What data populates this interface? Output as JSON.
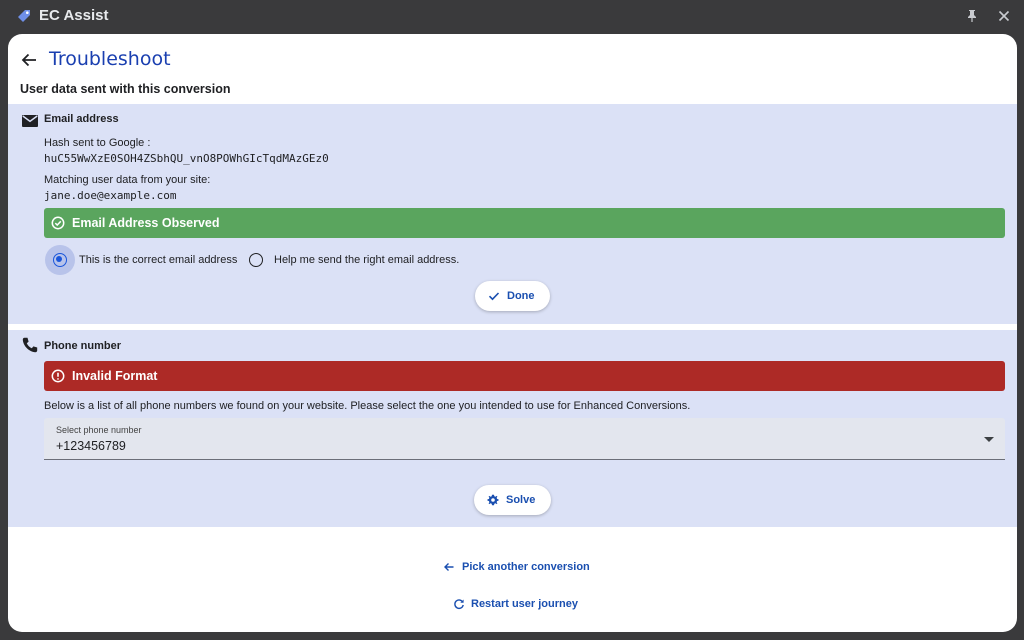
{
  "app": {
    "title": "EC Assist",
    "icon": "tag-icon",
    "pin_icon": "pin-icon",
    "close_icon": "close-icon"
  },
  "header": {
    "title": "Troubleshoot",
    "back_icon": "arrow-back-icon"
  },
  "section_heading": "User data sent with this conversion",
  "email": {
    "icon": "mail-icon",
    "label": "Email address",
    "hash_label": "Hash sent to Google :",
    "hash_value": "huC55WwXzE0SOH4ZSbhQU_vnO8POWhGIcTqdMAzGEz0",
    "match_label": "Matching user data from your site:",
    "match_value": "jane.doe@example.com",
    "status": {
      "text": "Email Address Observed",
      "icon": "check-circle-icon",
      "color": "#5aa55e"
    },
    "options": [
      {
        "label": "This is the correct email address",
        "selected": true
      },
      {
        "label": "Help me send the right email address.",
        "selected": false
      }
    ],
    "done_button": {
      "label": "Done",
      "icon": "check-icon"
    }
  },
  "phone": {
    "icon": "phone-icon",
    "label": "Phone number",
    "status": {
      "text": "Invalid Format",
      "icon": "error-circle-icon",
      "color": "#ad2a26"
    },
    "description": "Below is a list of all phone numbers we found on your website. Please select the one you intended to use for Enhanced Conversions.",
    "select": {
      "label": "Select phone number",
      "value": "+123456789",
      "icon": "dropdown-arrow-icon"
    },
    "solve_button": {
      "label": "Solve",
      "icon": "gear-icon"
    }
  },
  "footer": {
    "pick_link": {
      "label": "Pick another conversion",
      "icon": "arrow-back-icon"
    },
    "restart_link": {
      "label": "Restart user journey",
      "icon": "refresh-icon"
    }
  },
  "colors": {
    "accent": "#1a4fb0",
    "panel": "#dbe1f6",
    "success": "#5aa55e",
    "error": "#ad2a26"
  }
}
